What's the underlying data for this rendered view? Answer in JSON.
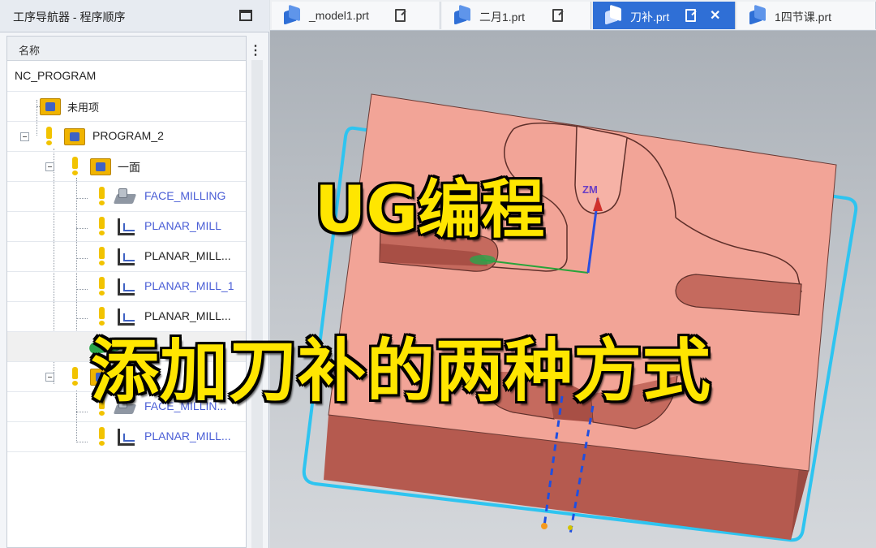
{
  "navigator": {
    "title": "工序导航器 - 程序顺序",
    "column_header": "名称",
    "rows": [
      {
        "label": "NC_PROGRAM"
      },
      {
        "label": "未用项"
      },
      {
        "label": "PROGRAM_2"
      },
      {
        "label": "一面"
      },
      {
        "label": "FACE_MILLING"
      },
      {
        "label": "PLANAR_MILL"
      },
      {
        "label": "PLANAR_MILL..."
      },
      {
        "label": "PLANAR_MILL_1"
      },
      {
        "label": "PLANAR_MILL..."
      },
      {
        "label": ""
      },
      {
        "label": ""
      },
      {
        "label": "FACE_MILLIN..."
      },
      {
        "label": "PLANAR_MILL..."
      }
    ]
  },
  "tabs": [
    {
      "label": "_model1.prt"
    },
    {
      "label": "二月1.prt"
    },
    {
      "label": "刀补.prt",
      "active": true
    },
    {
      "label": "1四节课.prt"
    }
  ],
  "viewport": {
    "axis_label": "ZM",
    "colors": {
      "part_top": "#f2a497",
      "part_side": "#b55a4f",
      "boundary": "#2ec4f0",
      "toolpath": "#1f4fe0",
      "z_axis": "#2a4fe0",
      "x_axis": "#28a43a"
    }
  },
  "captions": {
    "top": "UG编程",
    "bottom": "添加刀补的两种方式"
  }
}
